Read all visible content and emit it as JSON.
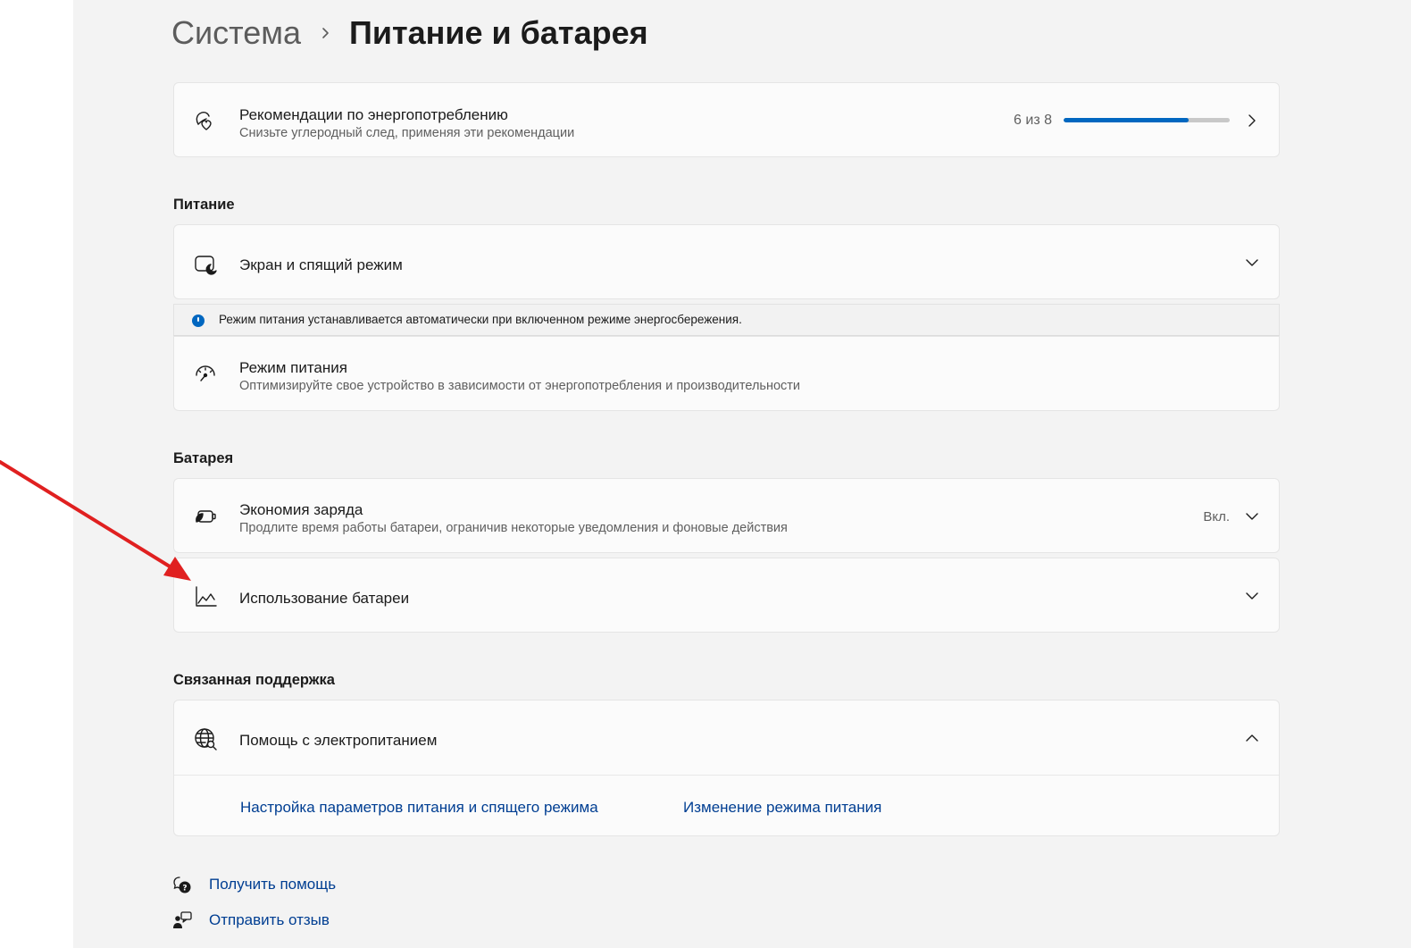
{
  "breadcrumb": {
    "parent": "Система",
    "current": "Питание и батарея"
  },
  "recommendations": {
    "title": "Рекомендации по энергопотреблению",
    "subtitle": "Снизьте углеродный след, применяя эти рекомендации",
    "progress_text": "6 из 8",
    "progress_fraction": 0.75
  },
  "sections": {
    "power": "Питание",
    "battery": "Батарея",
    "support": "Связанная поддержка"
  },
  "screen_sleep": {
    "title": "Экран и спящий режим"
  },
  "info_bar": {
    "text": "Режим питания устанавливается автоматически при включенном режиме энергосбережения."
  },
  "power_mode": {
    "title": "Режим питания",
    "subtitle": "Оптимизируйте свое устройство в зависимости от энергопотребления и производительности"
  },
  "battery_saver": {
    "title": "Экономия заряда",
    "subtitle": "Продлите время работы батареи, ограничив некоторые уведомления и фоновые действия",
    "value": "Вкл."
  },
  "battery_usage": {
    "title": "Использование батареи"
  },
  "power_help": {
    "title": "Помощь с электропитанием",
    "links": [
      "Настройка параметров питания и спящего режима",
      "Изменение режима питания"
    ]
  },
  "footer": {
    "get_help": "Получить помощь",
    "send_feedback": "Отправить отзыв"
  },
  "colors": {
    "accent": "#0067c0",
    "link": "#003e92",
    "annotation_arrow": "#e02020"
  },
  "icons": {
    "recommendations": "leaf-heart-icon",
    "screen_sleep": "screen-sleep-icon",
    "power_mode": "speedometer-icon",
    "battery_saver": "battery-saver-icon",
    "battery_usage": "chart-line-icon",
    "power_help": "globe-search-icon",
    "get_help": "help-chat-icon",
    "send_feedback": "feedback-person-icon"
  }
}
